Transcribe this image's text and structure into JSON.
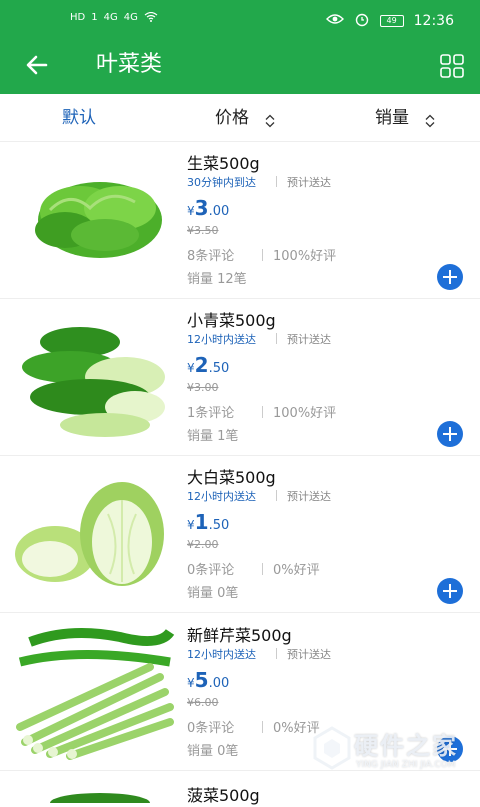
{
  "status_bar": {
    "left": [
      "HD",
      "1",
      "4G",
      "4G"
    ],
    "time": "12:36",
    "battery": "49"
  },
  "header": {
    "title": "叶菜类",
    "icons": [
      "back-arrow-icon",
      "grid-icon"
    ]
  },
  "sort_tabs": [
    {
      "label": "默认",
      "active": true
    },
    {
      "label": "价格",
      "active": false
    },
    {
      "label": "销量",
      "active": false
    }
  ],
  "products": [
    {
      "name": "生菜500g",
      "delivery": "30分钟内到达",
      "eta": "预计送达",
      "price_symbol": "¥",
      "price_int": "3",
      "price_dec": ".00",
      "old_price": "¥3.50",
      "reviews": "8条评论",
      "rating": "100%好评",
      "sales": "销量 12笔"
    },
    {
      "name": "小青菜500g",
      "delivery": "12小时内送达",
      "eta": "预计送达",
      "price_symbol": "¥",
      "price_int": "2",
      "price_dec": ".50",
      "old_price": "¥3.00",
      "reviews": "1条评论",
      "rating": "100%好评",
      "sales": "销量 1笔"
    },
    {
      "name": "大白菜500g",
      "delivery": "12小时内送达",
      "eta": "预计送达",
      "price_symbol": "¥",
      "price_int": "1",
      "price_dec": ".50",
      "old_price": "¥2.00",
      "reviews": "0条评论",
      "rating": "0%好评",
      "sales": "销量 0笔"
    },
    {
      "name": "新鲜芹菜500g",
      "delivery": "12小时内送达",
      "eta": "预计送达",
      "price_symbol": "¥",
      "price_int": "5",
      "price_dec": ".00",
      "old_price": "¥6.00",
      "reviews": "0条评论",
      "rating": "0%好评",
      "sales": "销量 0笔"
    },
    {
      "name": "菠菜500g"
    }
  ],
  "watermark": {
    "text": "硬件之家",
    "sub": "YING JIAN ZHI JIA.COM"
  },
  "colors": {
    "primary": "#22a84b",
    "accent": "#1e63b8",
    "add_button": "#1e6fd8"
  }
}
